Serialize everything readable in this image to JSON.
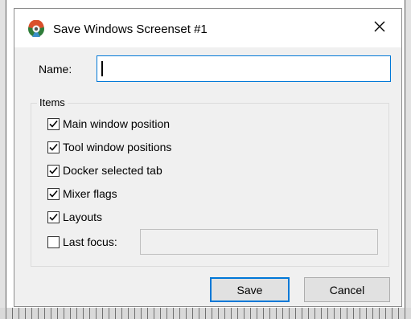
{
  "dialog": {
    "title": "Save Windows Screenset #1",
    "close_icon": "close-x-icon",
    "app_icon": "reaper-logo-icon"
  },
  "form": {
    "name_label": "Name:",
    "name_value": "",
    "group_label": "Items",
    "checkboxes": [
      {
        "label": "Main window position",
        "checked": true
      },
      {
        "label": "Tool window positions",
        "checked": true
      },
      {
        "label": "Docker selected tab",
        "checked": true
      },
      {
        "label": "Mixer flags",
        "checked": true
      },
      {
        "label": "Layouts",
        "checked": true
      },
      {
        "label": "Last focus:",
        "checked": false
      }
    ],
    "last_focus_value": ""
  },
  "buttons": {
    "save_label": "Save",
    "cancel_label": "Cancel"
  },
  "colors": {
    "accent": "#0078d7",
    "dialog_bg": "#f0f0f0",
    "titlebar_bg": "#ffffff"
  }
}
